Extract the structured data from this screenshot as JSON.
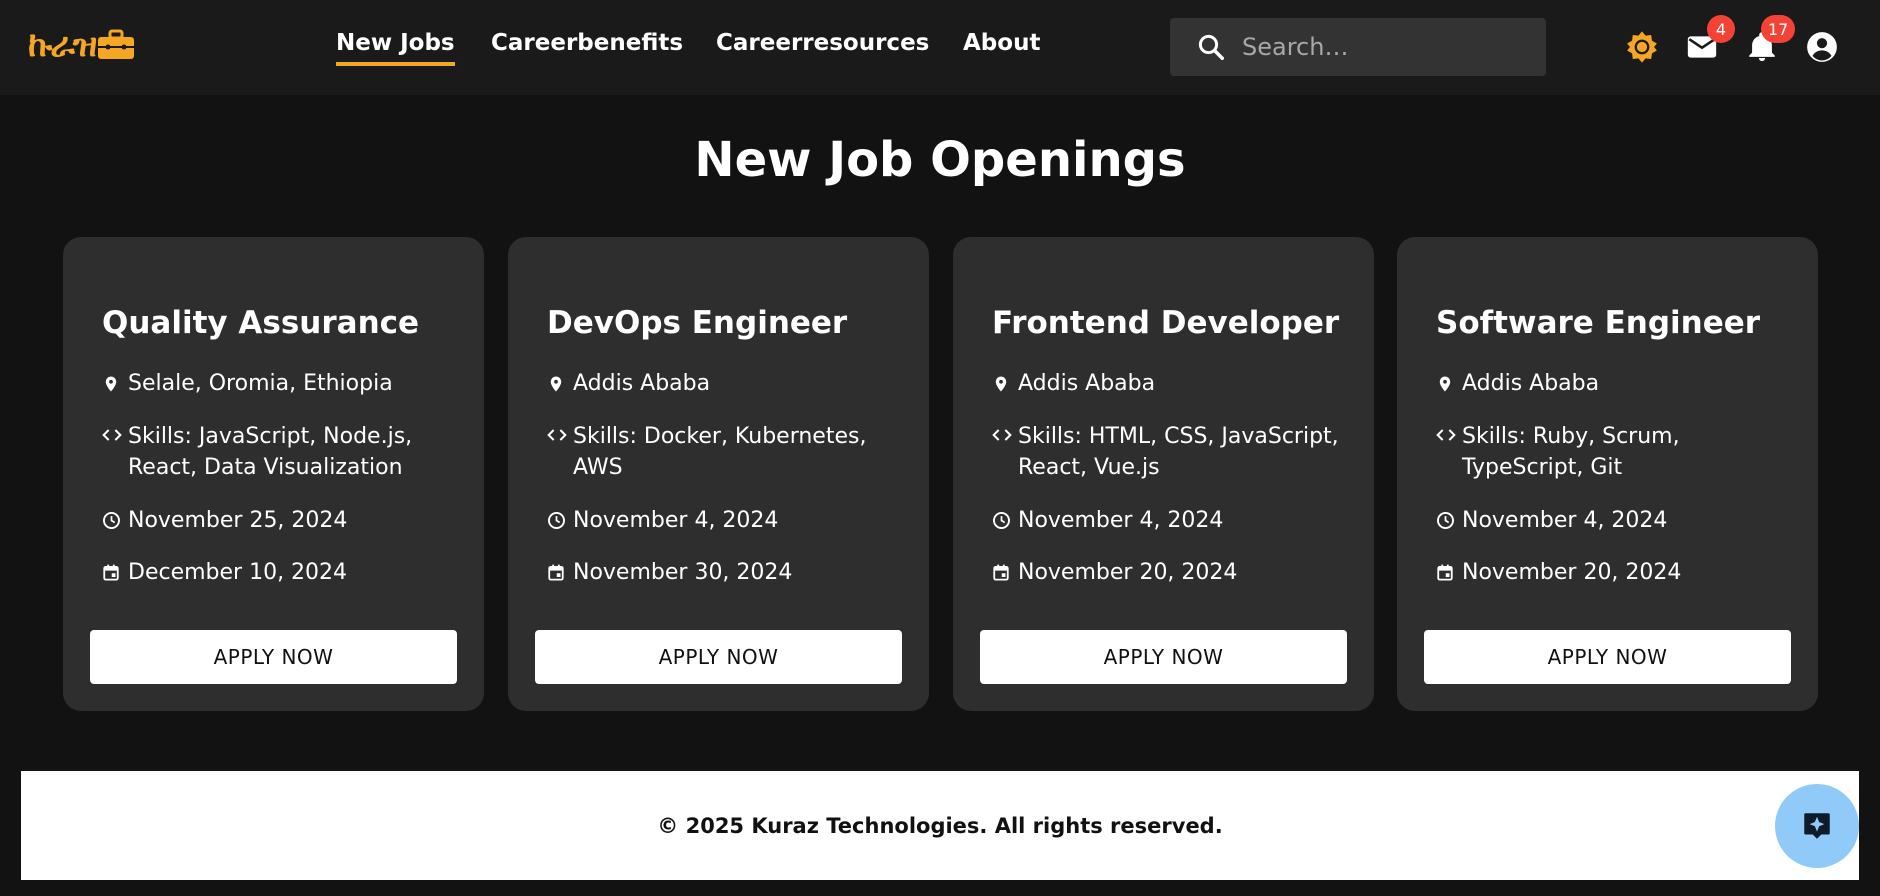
{
  "header": {
    "logo_text": "ኩራዝ",
    "nav": [
      {
        "label": "New Jobs",
        "active": true
      },
      {
        "label": "Careerbenefits",
        "active": false
      },
      {
        "label": "Careerresources",
        "active": false
      },
      {
        "label": "About",
        "active": false
      }
    ],
    "search": {
      "placeholder": "Search…",
      "value": ""
    },
    "messages_count": "4",
    "notifications_count": "17",
    "accent_color": "#f5a623"
  },
  "main": {
    "title": "New Job Openings",
    "jobs": [
      {
        "title": "Quality Assurance",
        "location": "Selale, Oromia, Ethiopia",
        "skills": "Skills: JavaScript, Node.js, React, Data Visualization",
        "posted": "November 25, 2024",
        "deadline": "December 10, 2024",
        "apply_label": "APPLY NOW"
      },
      {
        "title": "DevOps Engineer",
        "location": "Addis Ababa",
        "skills": "Skills: Docker, Kubernetes, AWS",
        "posted": "November 4, 2024",
        "deadline": "November 30, 2024",
        "apply_label": "APPLY NOW"
      },
      {
        "title": "Frontend Developer",
        "location": "Addis Ababa",
        "skills": "Skills: HTML, CSS, JavaScript, React, Vue.js",
        "posted": "November 4, 2024",
        "deadline": "November 20, 2024",
        "apply_label": "APPLY NOW"
      },
      {
        "title": "Software Engineer",
        "location": "Addis Ababa",
        "skills": "Skills: Ruby, Scrum, TypeScript, Git",
        "posted": "November 4, 2024",
        "deadline": "November 20, 2024",
        "apply_label": "APPLY NOW"
      }
    ]
  },
  "footer": {
    "copyright": "© 2025 Kuraz Technologies. All rights reserved."
  },
  "icons": [
    "logo-briefcase-icon",
    "search-icon",
    "theme-toggle-icon",
    "mail-icon",
    "bell-icon",
    "account-icon",
    "location-pin-icon",
    "code-icon",
    "clock-icon",
    "calendar-icon",
    "sparkle-icon"
  ]
}
